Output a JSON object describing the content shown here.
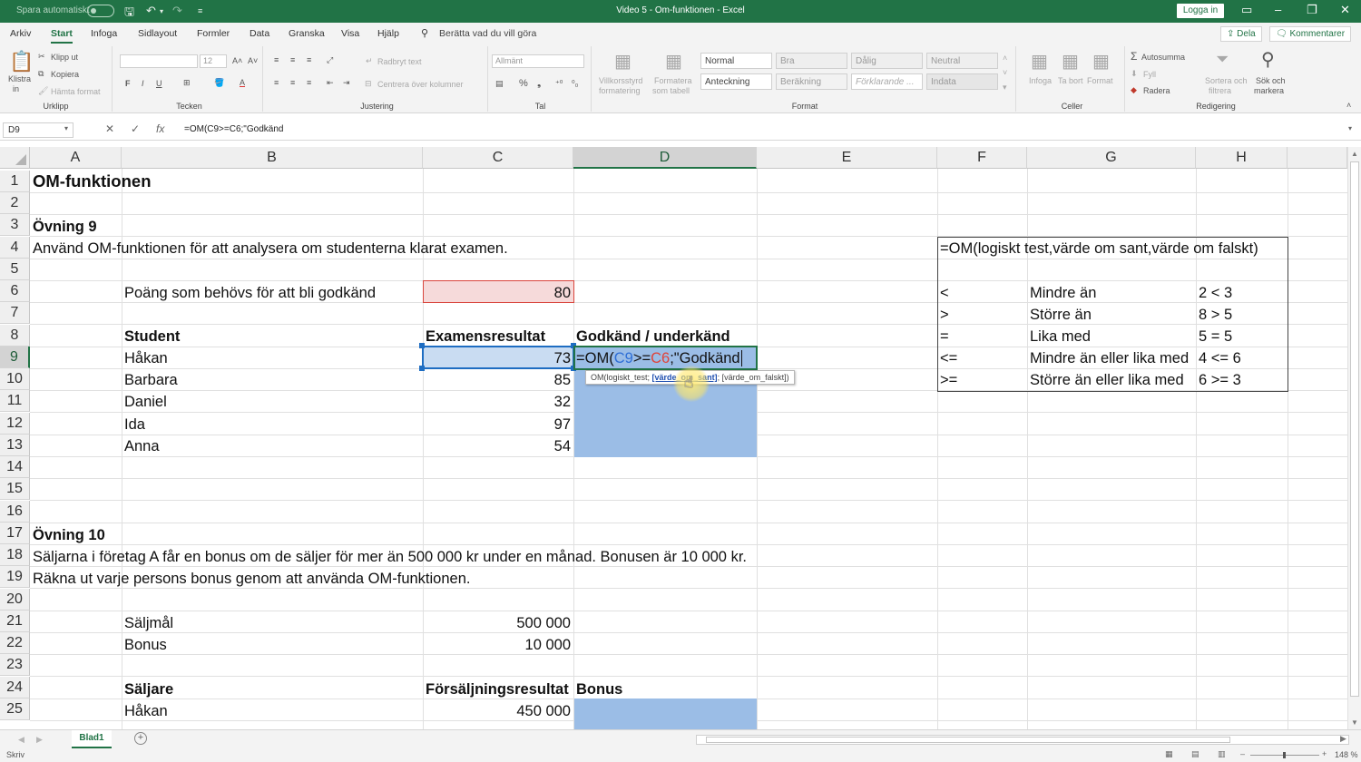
{
  "titlebar": {
    "autosave": "Spara automatiskt",
    "title": "Video 5 - Om-funktionen  -  Excel",
    "login": "Logga in"
  },
  "menu": {
    "items": [
      "Arkiv",
      "Start",
      "Infoga",
      "Sidlayout",
      "Formler",
      "Data",
      "Granska",
      "Visa",
      "Hjälp"
    ],
    "tell_me": "Berätta vad du vill göra",
    "share": "Dela",
    "comments": "Kommentarer"
  },
  "ribbon": {
    "clipboard": {
      "paste": "Klistra",
      "paste2": "in",
      "cut": "Klipp ut",
      "copy": "Kopiera",
      "format_painter": "Hämta format",
      "label": "Urklipp"
    },
    "font": {
      "size": "12",
      "label": "Tecken"
    },
    "alignment": {
      "wrap": "Radbryt text",
      "merge": "Centrera över kolumner",
      "label": "Justering"
    },
    "number": {
      "format": "Allmänt",
      "label": "Tal"
    },
    "styles": {
      "cond1": "Villkorsstyrd",
      "cond2": "formatering",
      "astable1": "Formatera",
      "astable2": "som tabell",
      "normal": "Normal",
      "good": "Bra",
      "bad": "Dålig",
      "neutral": "Neutral",
      "note": "Anteckning",
      "calc": "Beräkning",
      "explanatory": "Förklarande ...",
      "input": "Indata",
      "label": "Format"
    },
    "cells": {
      "insert": "Infoga",
      "delete": "Ta bort",
      "format": "Format",
      "label": "Celler"
    },
    "editing": {
      "autosum": "Autosumma",
      "fill": "Fyll",
      "clear": "Radera",
      "sort1": "Sortera och",
      "sort2": "filtrera",
      "find1": "Sök och",
      "find2": "markera",
      "label": "Redigering"
    }
  },
  "formula_bar": {
    "namebox": "D9",
    "formula": "=OM(C9>=C6;\"Godkänd"
  },
  "columns": [
    "A",
    "B",
    "C",
    "D",
    "E",
    "F",
    "G",
    "H"
  ],
  "rows": [
    "1",
    "2",
    "3",
    "4",
    "5",
    "6",
    "7",
    "8",
    "9",
    "10",
    "11",
    "12",
    "13",
    "14",
    "15",
    "16",
    "17",
    "18",
    "19",
    "20",
    "21",
    "22",
    "23",
    "24",
    "25"
  ],
  "sheet": {
    "a1": "OM-funktionen",
    "a3": "Övning 9",
    "a4": "Använd OM-funktionen för att analysera om studenterna klarat examen.",
    "b6": "Poäng som behövs för att bli godkänd",
    "c6": "80",
    "b8": "Student",
    "c8": "Examensresultat",
    "d8": "Godkänd / underkänd",
    "students": [
      {
        "name": "Håkan",
        "score": "73"
      },
      {
        "name": "Barbara",
        "score": "85"
      },
      {
        "name": "Daniel",
        "score": "32"
      },
      {
        "name": "Ida",
        "score": "97"
      },
      {
        "name": "Anna",
        "score": "54"
      }
    ],
    "d9_editing": {
      "p1": "=OM(",
      "ref1": "C9",
      "p2": ">=",
      "ref2": "C6",
      "p3": ";\"Godkänd"
    },
    "tooltip": {
      "part1": "OM(logiskt_test; ",
      "current": "[värde_om_sant]",
      "part2": "; [värde_om_falskt])"
    },
    "a17": "Övning 10",
    "a18": "Säljarna i företag A får en bonus om de säljer för mer än 500 000 kr under en månad. Bonusen är 10 000 kr.",
    "a19": "Räkna ut varje persons bonus genom att använda OM-funktionen.",
    "b21": "Säljmål",
    "c21": "500 000",
    "b22": "Bonus",
    "c22": "10 000",
    "b24": "Säljare",
    "c24": "Försäljningsresultat",
    "d24": "Bonus",
    "b25": "Håkan",
    "c25": "450 000",
    "f4": "=OM(logiskt test,värde om sant,värde om falskt)",
    "operators": [
      {
        "op": "<",
        "desc": "Mindre än",
        "ex": "2 < 3"
      },
      {
        "op": ">",
        "desc": "Större än",
        "ex": "8 > 5"
      },
      {
        "op": "=",
        "desc": "Lika med",
        "ex": "5 = 5"
      },
      {
        "op": "<=",
        "desc": "Mindre än eller lika med",
        "ex": "4 <= 6"
      },
      {
        "op": ">=",
        "desc": "Större än eller lika med",
        "ex": "6 >= 3"
      }
    ]
  },
  "tabs": {
    "sheet1": "Blad1"
  },
  "status": {
    "mode": "Skriv",
    "zoom": "148 %"
  }
}
